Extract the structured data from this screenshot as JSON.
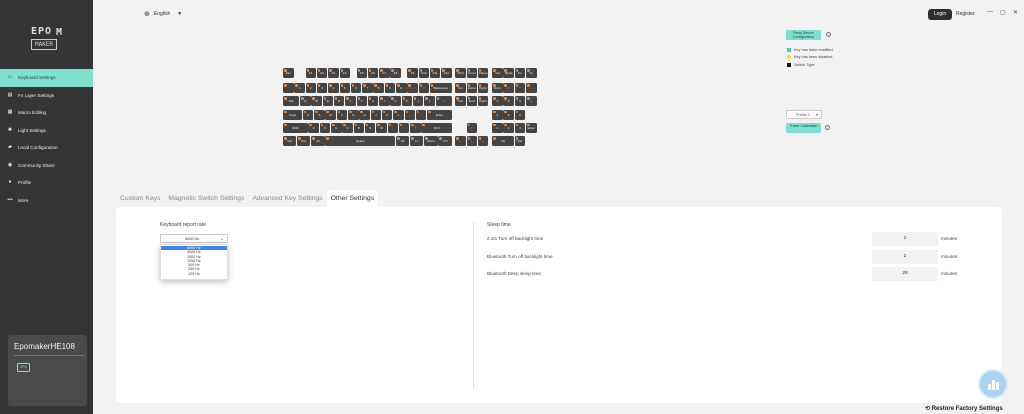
{
  "app": {
    "logo_text": "EPOMAKER",
    "language": "English",
    "login": "Login",
    "register": "Register",
    "window_controls": [
      "—",
      "▢",
      "✕"
    ]
  },
  "sidebar": {
    "items": [
      {
        "label": "Keyboard Settings",
        "icon": "keyboard-icon",
        "active": true
      },
      {
        "label": "Fn Layer Settings",
        "icon": "layers-icon",
        "active": false
      },
      {
        "label": "Macro Editing",
        "icon": "macro-icon",
        "active": false
      },
      {
        "label": "Light Settings",
        "icon": "light-icon",
        "active": false
      },
      {
        "label": "Local Configuration",
        "icon": "folder-icon",
        "active": false
      },
      {
        "label": "Community Share",
        "icon": "share-icon",
        "active": false
      },
      {
        "label": "Profile",
        "icon": "user-icon",
        "active": false
      },
      {
        "label": "More",
        "icon": "more-icon",
        "active": false
      }
    ],
    "device_name": "EpomakerHE108"
  },
  "keyboard": {
    "rows": [
      [
        "Esc",
        "F1",
        "F2",
        "F3",
        "F4",
        "F5",
        "F6",
        "F7",
        "F8",
        "F9",
        "F10",
        "F11",
        "F12",
        "Print",
        "Scroll",
        "Pause",
        "Cal",
        "Mode",
        "Fn",
        "Fn"
      ],
      [
        "`",
        "1",
        "2",
        "3",
        "4",
        "5",
        "6",
        "7",
        "8",
        "9",
        "0",
        "-",
        "=",
        "Backspace",
        "Ins",
        "Home",
        "PgUp",
        "Num",
        "/",
        "*",
        "-"
      ],
      [
        "Tab",
        "Q",
        "W",
        "E",
        "R",
        "T",
        "Y",
        "U",
        "I",
        "O",
        "P",
        "[",
        "]",
        "\\",
        "Del",
        "End",
        "PgDn",
        "7",
        "8",
        "9",
        "+"
      ],
      [
        "Caps",
        "A",
        "S",
        "D",
        "F",
        "G",
        "H",
        "J",
        "K",
        "L",
        ";",
        "'",
        "Enter",
        "4",
        "5",
        "6"
      ],
      [
        "Shift",
        "Z",
        "X",
        "C",
        "V",
        "B",
        "N",
        "M",
        ",",
        ".",
        "/",
        "Shift",
        "↑",
        "1",
        "2",
        "3",
        "Enter"
      ],
      [
        "Ctrl",
        "Win",
        "Alt",
        "Space",
        "Alt",
        "Fn",
        "Menu",
        "Ctrl",
        "←",
        "↓",
        "→",
        "Ins",
        "Del"
      ]
    ]
  },
  "right_panel": {
    "read_button": "Read Device Configuration",
    "legend": [
      {
        "label": "Key has been modified",
        "color": "#4ec9b0"
      },
      {
        "label": "Key has been disabled",
        "color": "#f0e040"
      },
      {
        "label": "Switch Type",
        "color": "#111111"
      }
    ],
    "profile": "Profile 1",
    "travel_button": "Travel Calibration"
  },
  "tabs": [
    "Custom Keys",
    "Magnetic Switch Settings",
    "Advanced Key Settings",
    "Other Settings"
  ],
  "active_tab": "Other Settings",
  "report_rate": {
    "label": "Keyboard report rate",
    "selected": "8000 Hz",
    "options": [
      "8000 Hz",
      "4000 Hz",
      "2000 Hz",
      "1000 Hz",
      "500 Hz",
      "250 Hz",
      "125 Hz"
    ]
  },
  "sleep": {
    "title": "Sleep time",
    "rows": [
      {
        "label": "2.4G Turn off backlight time",
        "value": "2",
        "unit": "minutes"
      },
      {
        "label": "Bluetooth Turn off backlight time",
        "value": "2",
        "unit": "minutes"
      },
      {
        "label": "Bluetooth Deep sleep time",
        "value": "28",
        "unit": "minutes"
      }
    ]
  },
  "restore_button": "Restore Factory Settings"
}
